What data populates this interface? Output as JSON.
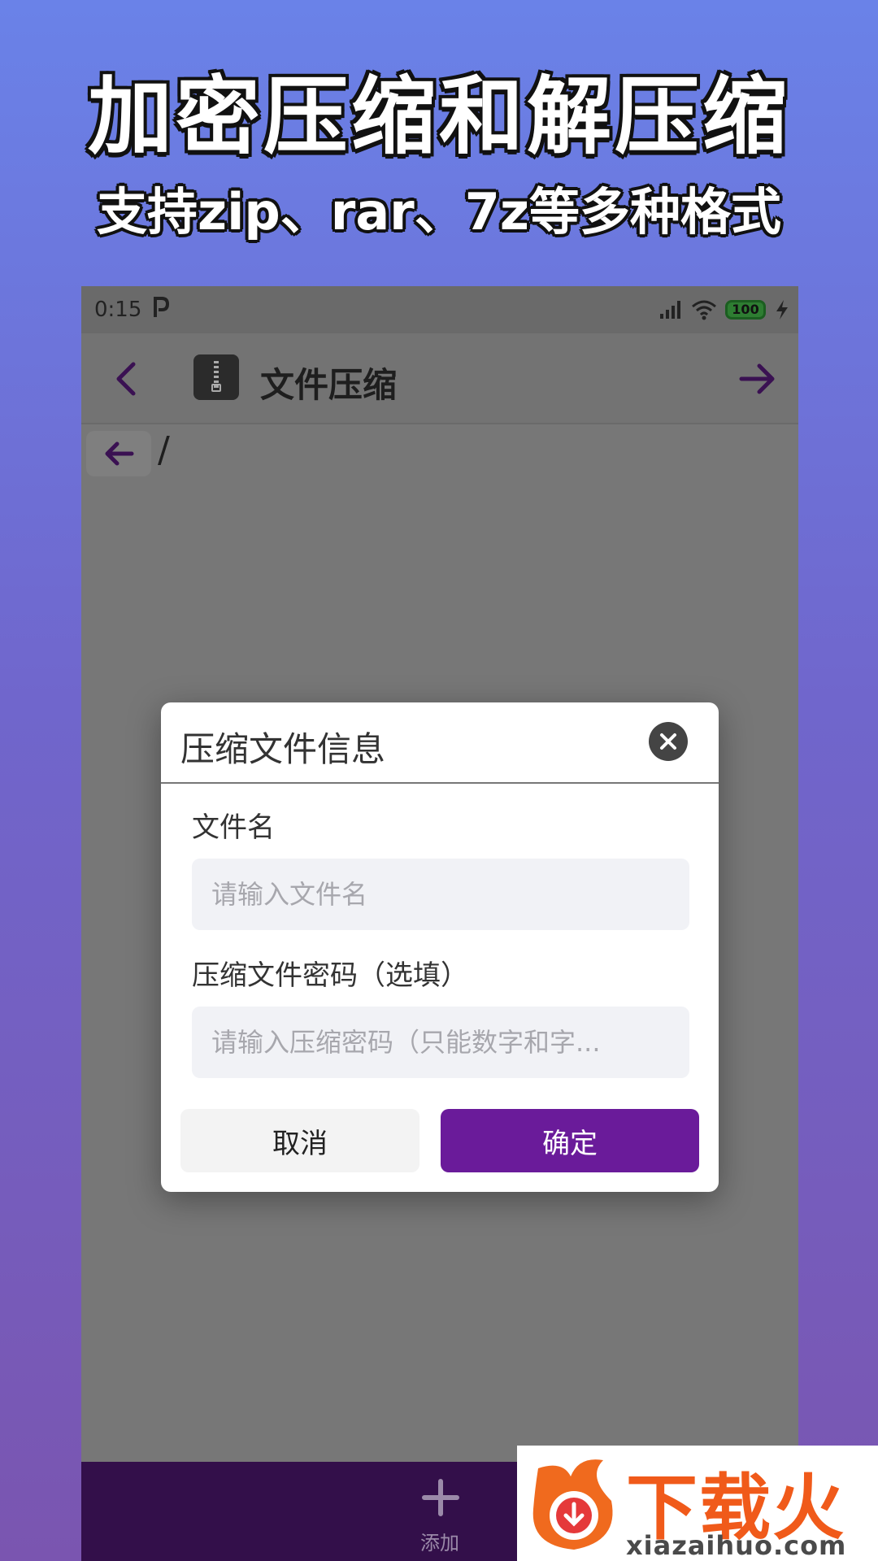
{
  "promo": {
    "title": "加密压缩和解压缩",
    "subtitle": "支持zip、rar、7z等多种格式"
  },
  "status_bar": {
    "time": "0:15",
    "battery": "100"
  },
  "app_bar": {
    "title": "文件压缩"
  },
  "path": {
    "current": "/"
  },
  "dialog": {
    "title": "压缩文件信息",
    "file_name_label": "文件名",
    "file_name_placeholder": "请输入文件名",
    "password_label": "压缩文件密码（选填）",
    "password_placeholder": "请输入压缩密码（只能数字和字...",
    "cancel_label": "取消",
    "confirm_label": "确定"
  },
  "bottom_nav": {
    "add_label": "添加"
  },
  "watermark": {
    "brand": "下载火",
    "url": "xiazaihuo.com"
  },
  "colors": {
    "accent": "#6a1b9a",
    "bottom_nav": "#330f4a",
    "overlay": "#777777"
  }
}
